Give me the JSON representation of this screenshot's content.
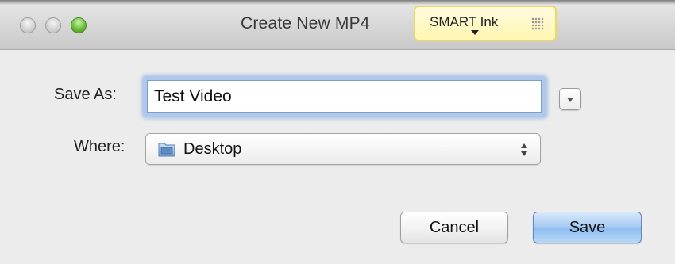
{
  "window": {
    "title": "Create New MP4"
  },
  "smart_ink": {
    "label": "SMART Ink",
    "accent_color": "#fff6b0",
    "border_color": "#f0d860"
  },
  "form": {
    "save_as_label": "Save As:",
    "save_as_value": "Test Video",
    "where_label": "Where:",
    "where_value": "Desktop",
    "where_icon": "folder-icon"
  },
  "buttons": {
    "cancel_label": "Cancel",
    "save_label": "Save"
  },
  "colors": {
    "focus_ring": "#6ea0e6",
    "default_button": "#8fbdf0",
    "zoom_button": "#6bbf3b"
  }
}
